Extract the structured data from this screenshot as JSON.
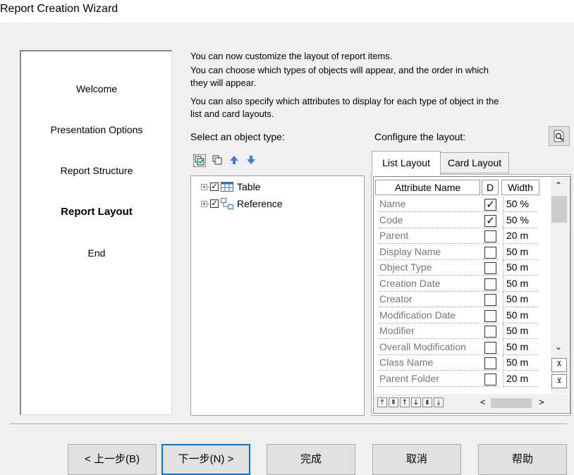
{
  "window": {
    "title": "Report Creation Wizard"
  },
  "steps": [
    {
      "label": "Welcome",
      "current": false
    },
    {
      "label": "Presentation Options",
      "current": false
    },
    {
      "label": "Report Structure",
      "current": false
    },
    {
      "label": "Report Layout",
      "current": true
    },
    {
      "label": "End",
      "current": false
    }
  ],
  "description": {
    "line1": "You can now customize the layout of report items.",
    "line2": "You can choose which types of objects will appear, and the order in which",
    "line3": "they will appear.",
    "line4": "You can also specify which attributes to display for each type of object in the",
    "line5": "list and card layouts."
  },
  "object_types": {
    "label": "Select an object type:",
    "items": [
      {
        "label": "Table",
        "checked": true,
        "icon": "table-icon"
      },
      {
        "label": "Reference",
        "checked": true,
        "icon": "reference-icon"
      }
    ]
  },
  "layout": {
    "label": "Configure the layout:",
    "tabs": {
      "list": "List Layout",
      "card": "Card Layout"
    },
    "columns": {
      "name": "Attribute Name",
      "display": "D",
      "width": "Width"
    },
    "rows": [
      {
        "name": "Name",
        "checked": true,
        "width": "50 %"
      },
      {
        "name": "Code",
        "checked": true,
        "width": "50 %"
      },
      {
        "name": "Parent",
        "checked": false,
        "width": "20 m"
      },
      {
        "name": "Display Name",
        "checked": false,
        "width": "50 m"
      },
      {
        "name": "Object Type",
        "checked": false,
        "width": "50 m"
      },
      {
        "name": "Creation Date",
        "checked": false,
        "width": "50 m"
      },
      {
        "name": "Creator",
        "checked": false,
        "width": "50 m"
      },
      {
        "name": "Modification Date",
        "checked": false,
        "width": "50 m"
      },
      {
        "name": "Modifier",
        "checked": false,
        "width": "50 m"
      },
      {
        "name": "Overall Modification",
        "checked": false,
        "width": "50 m"
      },
      {
        "name": "Class Name",
        "checked": false,
        "width": "50 m"
      },
      {
        "name": "Parent Folder",
        "checked": false,
        "width": "20 m"
      }
    ]
  },
  "buttons": {
    "back": "< 上一步(B)",
    "next": "下一步(N) >",
    "finish": "完成",
    "cancel": "取消",
    "help": "帮助"
  }
}
